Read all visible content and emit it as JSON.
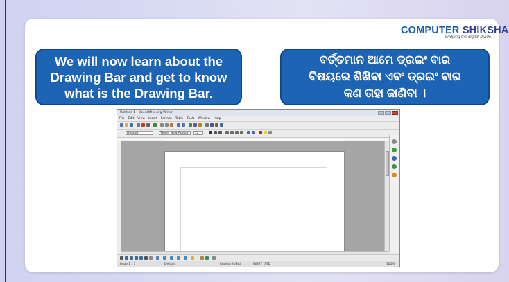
{
  "logo": {
    "computer": "COMPUTER",
    "shiksha": "SHIKSHA",
    "tagline": "bridging the digital divide"
  },
  "bubbles": {
    "english": "We will now learn about the Drawing Bar and get to know what is the Drawing Bar.",
    "odia": "ବର୍ତ୍ତମାନ ଆମେ ଡ୍ରଇଂ ବାର ବିଷୟରେ ଶିଖିବା ଏବଂ ଡ୍ରଇଂ ବାର କଣ ତାହା ଜାଣିବା ।"
  },
  "writer": {
    "title": "Untitled 1 - OpenOffice.org Writer",
    "menu": [
      "File",
      "Edit",
      "View",
      "Insert",
      "Format",
      "Table",
      "Tools",
      "Window",
      "Help"
    ],
    "style_value": "Default",
    "font_value": "Times New Roman",
    "size_value": "12",
    "status": {
      "page": "Page 1 / 1",
      "style": "Default",
      "language": "English (USA)",
      "mode": "INSRT",
      "selection": "STD",
      "zoom": "100%"
    }
  },
  "colors": {
    "bubble": "#1e64b4",
    "logo_blue": "#1b5fa8"
  }
}
